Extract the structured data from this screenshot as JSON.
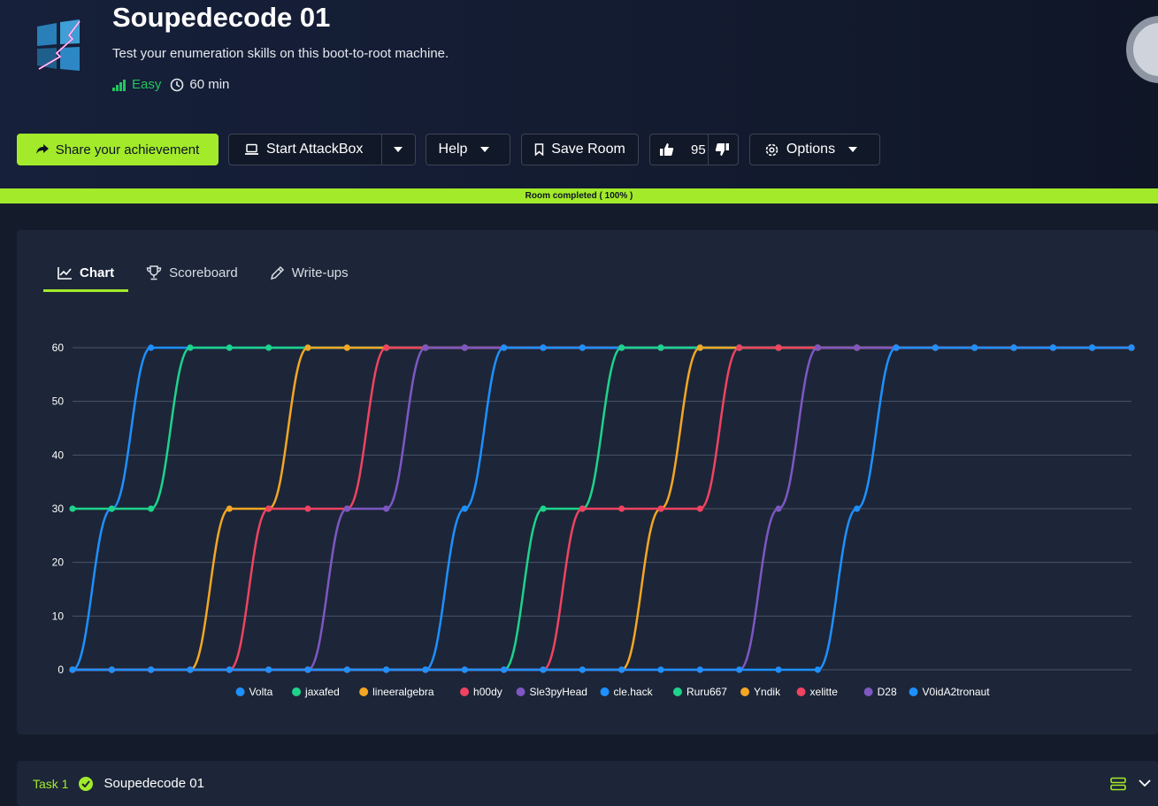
{
  "room": {
    "title": "Soupedecode 01",
    "description": "Test your enumeration skills on this boot-to-root machine.",
    "difficulty": "Easy",
    "duration": "60 min"
  },
  "toolbar": {
    "share_label": "Share your achievement",
    "attackbox_label": "Start AttackBox",
    "help_label": "Help",
    "save_label": "Save Room",
    "likes": "95",
    "options_label": "Options"
  },
  "progress": {
    "label": "Room completed ( 100% )",
    "value": 100
  },
  "tabs": [
    {
      "label": "Chart",
      "icon": "chart-icon",
      "active": true
    },
    {
      "label": "Scoreboard",
      "icon": "trophy-icon",
      "active": false
    },
    {
      "label": "Write-ups",
      "icon": "pencil-icon",
      "active": false
    }
  ],
  "chart_data": {
    "type": "line",
    "ylim": [
      0,
      60
    ],
    "yticks": [
      0,
      10,
      20,
      30,
      40,
      50,
      60
    ],
    "grid": true,
    "legend": "bottom",
    "series": [
      {
        "name": "Volta",
        "color": "#1e90ff",
        "values": [
          0,
          30,
          60,
          60,
          60,
          60,
          60,
          60,
          60,
          60,
          60,
          60,
          60,
          60,
          60,
          60,
          60,
          60,
          60,
          60,
          60,
          60,
          60,
          60,
          60,
          60,
          60,
          60
        ]
      },
      {
        "name": "jaxafed",
        "color": "#1ed38b",
        "values": [
          30,
          30,
          30,
          60,
          60,
          60,
          60,
          60,
          60,
          60,
          60,
          60,
          60,
          60,
          60,
          60,
          60,
          60,
          60,
          60,
          60,
          60,
          60,
          60,
          60,
          60,
          60,
          60
        ]
      },
      {
        "name": "lineeralgebra",
        "color": "#f5a623",
        "values": [
          0,
          0,
          0,
          0,
          30,
          30,
          60,
          60,
          60,
          60,
          60,
          60,
          60,
          60,
          60,
          60,
          60,
          60,
          60,
          60,
          60,
          60,
          60,
          60,
          60,
          60,
          60,
          60
        ]
      },
      {
        "name": "h00dy",
        "color": "#ef4361",
        "values": [
          0,
          0,
          0,
          0,
          0,
          30,
          30,
          30,
          60,
          60,
          60,
          60,
          60,
          60,
          60,
          60,
          60,
          60,
          60,
          60,
          60,
          60,
          60,
          60,
          60,
          60,
          60,
          60
        ]
      },
      {
        "name": "Sle3pyHead",
        "color": "#7e57c2",
        "values": [
          0,
          0,
          0,
          0,
          0,
          0,
          0,
          30,
          30,
          60,
          60,
          60,
          60,
          60,
          60,
          60,
          60,
          60,
          60,
          60,
          60,
          60,
          60,
          60,
          60,
          60,
          60,
          60
        ]
      },
      {
        "name": "cle.hack",
        "color": "#1e90ff",
        "values": [
          0,
          0,
          0,
          0,
          0,
          0,
          0,
          0,
          0,
          0,
          30,
          60,
          60,
          60,
          60,
          60,
          60,
          60,
          60,
          60,
          60,
          60,
          60,
          60,
          60,
          60,
          60,
          60
        ]
      },
      {
        "name": "Ruru667",
        "color": "#1ed38b",
        "values": [
          0,
          0,
          0,
          0,
          0,
          0,
          0,
          0,
          0,
          0,
          0,
          0,
          30,
          30,
          60,
          60,
          60,
          60,
          60,
          60,
          60,
          60,
          60,
          60,
          60,
          60,
          60,
          60
        ]
      },
      {
        "name": "Yndik",
        "color": "#f5a623",
        "values": [
          0,
          0,
          0,
          0,
          0,
          0,
          0,
          0,
          0,
          0,
          0,
          0,
          0,
          0,
          0,
          30,
          60,
          60,
          60,
          60,
          60,
          60,
          60,
          60,
          60,
          60,
          60,
          60
        ]
      },
      {
        "name": "xelitte",
        "color": "#ef4361",
        "values": [
          0,
          0,
          0,
          0,
          0,
          0,
          0,
          0,
          0,
          0,
          0,
          0,
          0,
          30,
          30,
          30,
          30,
          60,
          60,
          60,
          60,
          60,
          60,
          60,
          60,
          60,
          60,
          60
        ]
      },
      {
        "name": "D28",
        "color": "#7e57c2",
        "values": [
          0,
          0,
          0,
          0,
          0,
          0,
          0,
          0,
          0,
          0,
          0,
          0,
          0,
          0,
          0,
          0,
          0,
          0,
          30,
          60,
          60,
          60,
          60,
          60,
          60,
          60,
          60,
          60
        ]
      },
      {
        "name": "V0idA2tronaut",
        "color": "#1e90ff",
        "values": [
          0,
          0,
          0,
          0,
          0,
          0,
          0,
          0,
          0,
          0,
          0,
          0,
          0,
          0,
          0,
          0,
          0,
          0,
          0,
          0,
          30,
          60,
          60,
          60,
          60,
          60,
          60,
          60
        ]
      }
    ]
  },
  "task": {
    "number_label": "Task 1",
    "title": "Soupedecode 01"
  }
}
